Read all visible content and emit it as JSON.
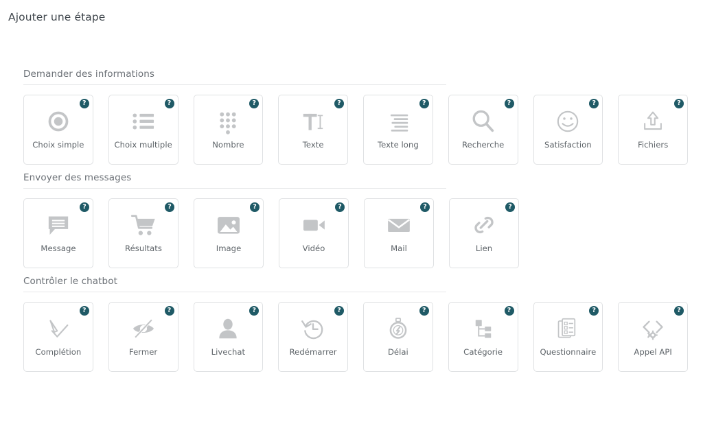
{
  "page": {
    "title": "Ajouter une étape"
  },
  "colors": {
    "badge_teal": "#1f5a66",
    "icon_gray": "#c3c5c7",
    "card_border": "#dfe1e3",
    "divider": "#e6e7e9",
    "label_text": "#5d6368",
    "header_text": "#6b7076"
  },
  "badge": {
    "glyph": "?",
    "name": "help-badge"
  },
  "sections": [
    {
      "id": "demander-des-informations",
      "header": "Demander des informations",
      "cards": [
        {
          "label": "Choix simple",
          "icon": "radio-button-icon"
        },
        {
          "label": "Choix multiple",
          "icon": "bulleted-list-icon"
        },
        {
          "label": "Nombre",
          "icon": "keypad-dots-icon"
        },
        {
          "label": "Texte",
          "icon": "text-cursor-icon"
        },
        {
          "label": "Texte long",
          "icon": "paragraph-lines-icon"
        },
        {
          "label": "Recherche",
          "icon": "magnifier-icon"
        },
        {
          "label": "Satisfaction",
          "icon": "smiley-face-icon"
        },
        {
          "label": "Fichiers",
          "icon": "upload-arrow-icon"
        }
      ]
    },
    {
      "id": "envoyer-des-messages",
      "header": "Envoyer des messages",
      "cards": [
        {
          "label": "Message",
          "icon": "speech-bubble-icon"
        },
        {
          "label": "Résultats",
          "icon": "shopping-cart-icon"
        },
        {
          "label": "Image",
          "icon": "picture-icon"
        },
        {
          "label": "Vidéo",
          "icon": "video-camera-icon"
        },
        {
          "label": "Mail",
          "icon": "envelope-icon"
        },
        {
          "label": "Lien",
          "icon": "chain-link-icon"
        }
      ]
    },
    {
      "id": "controler-le-chatbot",
      "header": "Contrôler le chatbot",
      "cards": [
        {
          "label": "Complétion",
          "icon": "checkmark-pen-icon"
        },
        {
          "label": "Fermer",
          "icon": "eye-slash-icon"
        },
        {
          "label": "Livechat",
          "icon": "person-icon"
        },
        {
          "label": "Redémarrer",
          "icon": "clock-rewind-icon"
        },
        {
          "label": "Délai",
          "icon": "stopwatch-icon"
        },
        {
          "label": "Catégorie",
          "icon": "hierarchy-tree-icon"
        },
        {
          "label": "Questionnaire",
          "icon": "survey-clipboard-icon"
        },
        {
          "label": "Appel API",
          "icon": "code-gear-icon"
        }
      ]
    }
  ]
}
